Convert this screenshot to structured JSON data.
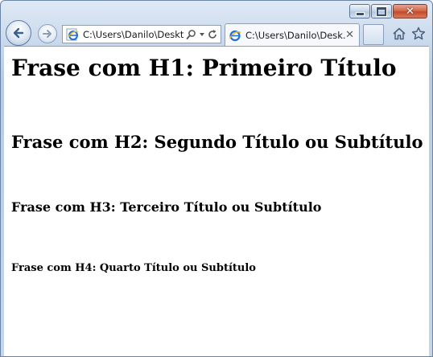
{
  "browser": {
    "address": {
      "url": "C:\\Users\\Danilo\\Deskt"
    },
    "tab": {
      "title": "C:\\Users\\Danilo\\Desk...",
      "close_glyph": "✕"
    },
    "icons": {
      "back": "back-arrow-icon",
      "forward": "forward-arrow-icon",
      "page": "ie-page-icon",
      "search": "search-icon",
      "dropdown": "dropdown-icon",
      "refresh": "refresh-icon",
      "home": "home-icon",
      "favorites": "star-icon",
      "minimize": "minimize-icon",
      "maximize": "maximize-icon",
      "close": "close-icon"
    },
    "colors": {
      "frame": "#c6d6ea",
      "close_button": "#c44a2b",
      "ie_blue": "#1f6fd6",
      "ie_ring": "#f2b81a"
    }
  },
  "page": {
    "h1": "Frase com H1: Primeiro Título",
    "h2": "Frase com H2: Segundo Título ou Subtítulo",
    "h3": "Frase com H3: Terceiro Título ou Subtítulo",
    "h4": "Frase com H4: Quarto Título ou Subtítulo"
  }
}
